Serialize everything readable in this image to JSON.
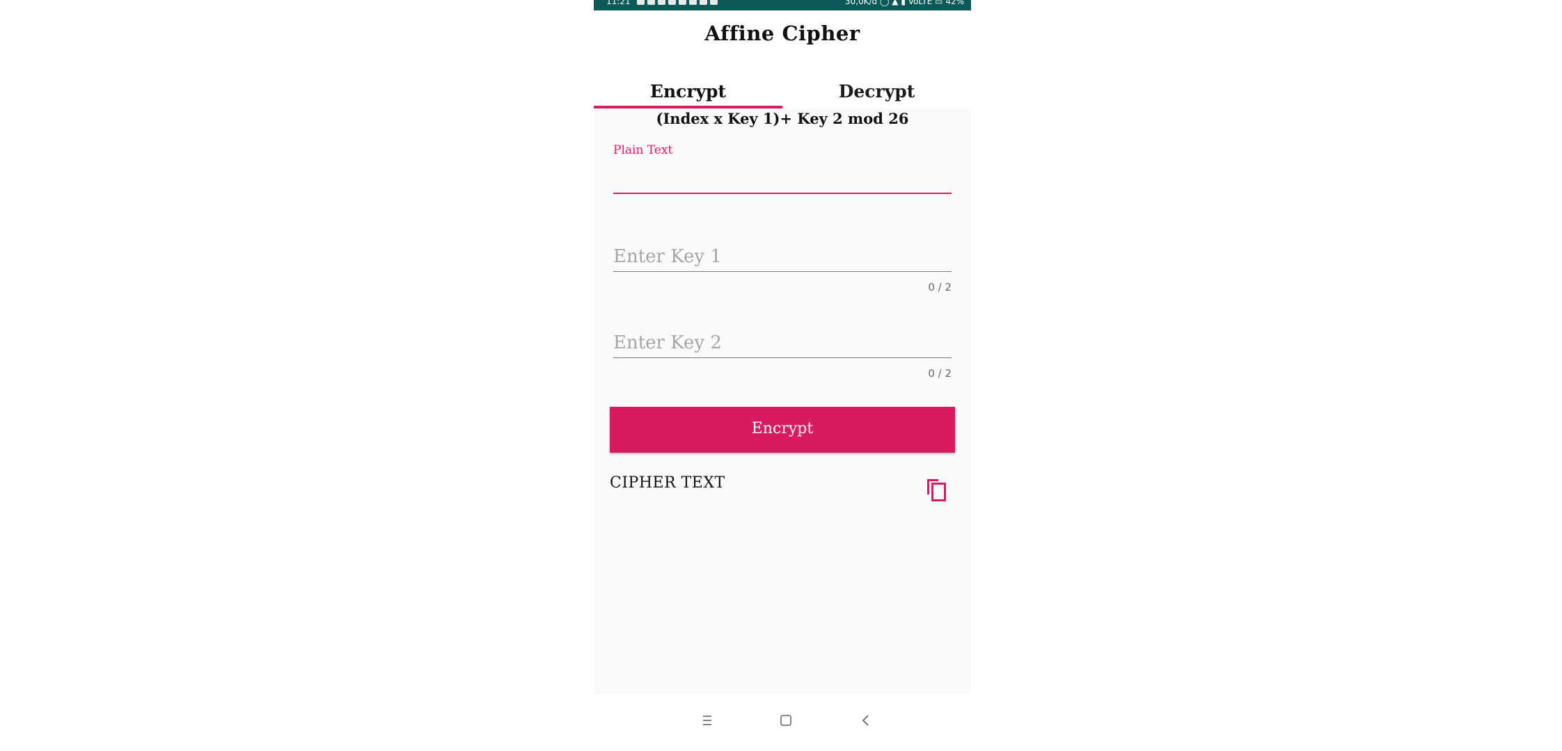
{
  "status_bar": {
    "time": "11:21",
    "network_speed": "30,0K/d",
    "carrier": "VoLTE",
    "battery": "42%"
  },
  "app": {
    "title": "Affine Cipher"
  },
  "tabs": [
    {
      "label": "Encrypt",
      "selected": true
    },
    {
      "label": "Decrypt",
      "selected": false
    }
  ],
  "form": {
    "formula": "(Index x Key 1)+ Key 2 mod 26",
    "plain_text": {
      "label": "Plain Text",
      "value": ""
    },
    "key1": {
      "placeholder": "Enter Key 1",
      "counter": "0 / 2",
      "value": ""
    },
    "key2": {
      "placeholder": "Enter Key 2",
      "counter": "0 / 2",
      "value": ""
    },
    "encrypt_button": "Encrypt",
    "cipher_text_label": "CIPHER TEXT"
  },
  "colors": {
    "accent": "#d81b60",
    "status_bar": "#0c5a58",
    "content_bg": "#fafafa"
  },
  "icons": {
    "copy": "copy-icon",
    "nav_menu": "menu-icon",
    "nav_home": "home-icon",
    "nav_back": "back-icon"
  }
}
